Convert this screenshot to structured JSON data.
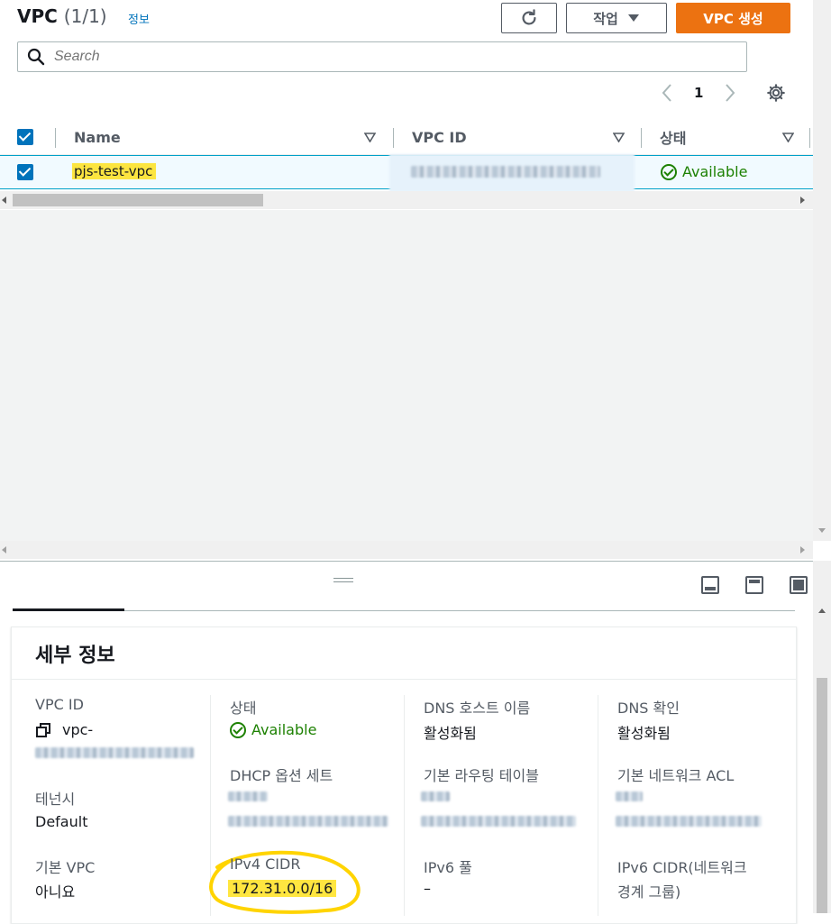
{
  "header": {
    "title": "VPC",
    "count": "(1/1)",
    "info_link": "정보",
    "action_label": "작업",
    "create_label": "VPC 생성"
  },
  "search": {
    "placeholder": "Search"
  },
  "pagination": {
    "page": "1"
  },
  "table": {
    "columns": [
      "Name",
      "VPC ID",
      "상태"
    ],
    "rows": [
      {
        "name": "pjs-test-vpc",
        "status": "Available",
        "selected": true
      }
    ]
  },
  "details": {
    "title": "세부 정보",
    "vpc_id_label": "VPC ID",
    "vpc_id_prefix": "vpc-",
    "tenancy_label": "테넌시",
    "tenancy_value": "Default",
    "default_vpc_label": "기본 VPC",
    "default_vpc_value": "아니요",
    "status_label": "상태",
    "status_value": "Available",
    "dhcp_label": "DHCP 옵션 세트",
    "ipv4_label": "IPv4 CIDR",
    "ipv4_value": "172.31.0.0/16",
    "dns_hostname_label": "DNS 호스트 이름",
    "dns_hostname_value": "활성화됨",
    "routing_label": "기본 라우팅 테이블",
    "ipv6_pool_label": "IPv6 풀",
    "ipv6_pool_value": "–",
    "dns_resolution_label": "DNS 확인",
    "dns_resolution_value": "활성화됨",
    "acl_label": "기본 네트워크 ACL",
    "ipv6_cidr_label_1": "IPv6 CIDR(네트워크",
    "ipv6_cidr_label_2": "경계 그룹)"
  },
  "colors": {
    "primary": "#ec7211",
    "link": "#0073bb",
    "success": "#1d8102",
    "highlight": "#ffde00"
  }
}
